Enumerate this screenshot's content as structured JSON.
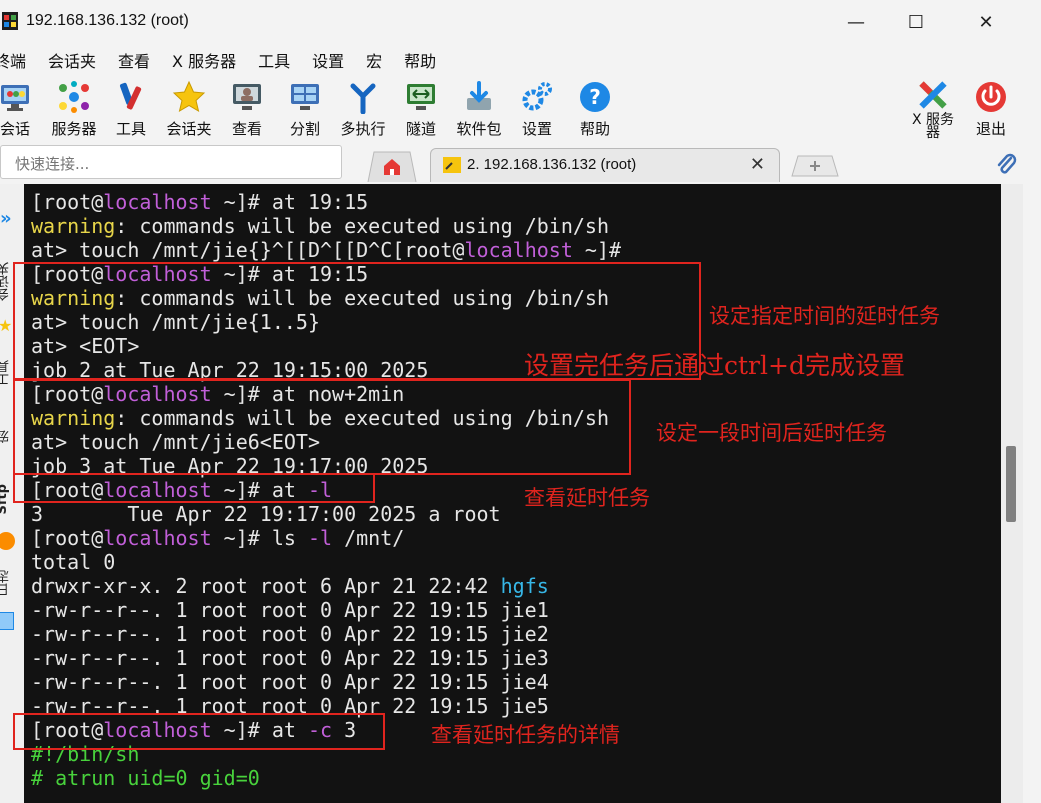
{
  "window": {
    "title": "192.168.136.132 (root)",
    "minimize": "—",
    "maximize": "☐",
    "close": "✕"
  },
  "menu": [
    "终端",
    "会话夹",
    "查看",
    "X 服务器",
    "工具",
    "设置",
    "宏",
    "帮助"
  ],
  "toolbar": {
    "items": [
      "会话",
      "服务器",
      "工具",
      "会话夹",
      "查看",
      "分割",
      "多执行",
      "隧道",
      "软件包",
      "设置",
      "帮助"
    ],
    "xserver_label_1": "X 服务",
    "xserver_label_2": "器",
    "exit_label": "退出"
  },
  "quick_connect": {
    "placeholder": "快速连接..."
  },
  "tab": {
    "label": "2. 192.168.136.132 (root)",
    "close": "✕"
  },
  "side_labels": [
    "会话夹",
    "工具",
    "宏",
    "Sftp",
    "日志"
  ],
  "terminal": {
    "prompt_open": "[root@",
    "host": "localhost",
    "prompt_close": " ~]# ",
    "warning_word": "warning",
    "warning_rest": ": commands will be executed using /bin/sh",
    "cmd_at_1915": "at 19:15",
    "line3": "at> touch /mnt/jie{}^[[D^[[D^C[root@",
    "line3_tail": " ~]#",
    "line6": "at> touch /mnt/jie{1..5}",
    "line7": "at> <EOT>",
    "line8": "job 2 at Tue Apr 22 19:15:00 2025",
    "cmd_now": "at now+2min",
    "line11": "at> touch /mnt/jie6<EOT>",
    "line12": "job 3 at Tue Apr 22 19:17:00 2025",
    "cmd_at_l": "at ",
    "flag_l": "-l",
    "line14": "3       Tue Apr 22 19:17:00 2025 a root",
    "cmd_ls": "ls ",
    "cmd_ls_tail": " /mnt/",
    "line16": "total 0",
    "line17": "drwxr-xr-x. 2 root root 6 Apr 21 22:42 ",
    "line17_dir": "hgfs",
    "files": [
      "-rw-r--r--. 1 root root 0 Apr 22 19:15 jie1",
      "-rw-r--r--. 1 root root 0 Apr 22 19:15 jie2",
      "-rw-r--r--. 1 root root 0 Apr 22 19:15 jie3",
      "-rw-r--r--. 1 root root 0 Apr 22 19:15 jie4",
      "-rw-r--r--. 1 root root 0 Apr 22 19:15 jie5"
    ],
    "flag_c": "-c",
    "cmd_c_tail": " 3",
    "line24": "#!/bin/sh",
    "line25": "# atrun uid=0 gid=0"
  },
  "annotations": {
    "fixed_time": "设定指定时间的延时任务",
    "ctrl_d": "设置完任务后通过ctrl+d完成设置",
    "relative_time": "设定一段时间后延时任务",
    "list_jobs": "查看延时任务",
    "job_detail": "查看延时任务的详情"
  },
  "colors": {
    "terminal_bg": "#121212",
    "host": "#c15fd8",
    "warning": "#e8d64a",
    "directory": "#37b7e7",
    "script_green": "#48d23c",
    "annotation_red": "#e0241e"
  }
}
